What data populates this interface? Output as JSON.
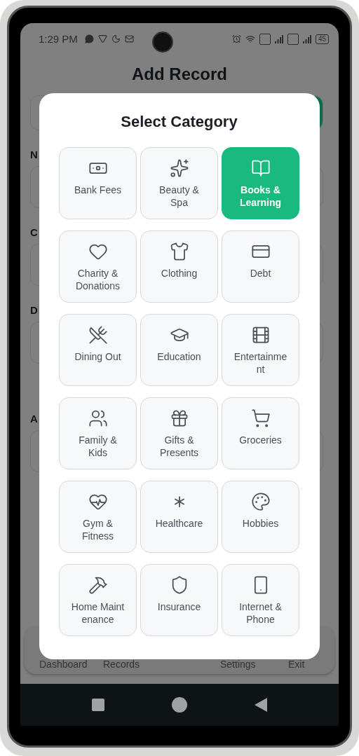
{
  "status_bar": {
    "time": "1:29 PM",
    "battery": "45"
  },
  "page": {
    "title": "Add Record",
    "fields": [
      {
        "label": "N"
      },
      {
        "label": "C"
      },
      {
        "label": "D"
      },
      {
        "label": "A"
      }
    ]
  },
  "dialog": {
    "title": "Select Category",
    "categories": [
      {
        "label": "Bank Fees",
        "selected": false
      },
      {
        "label": "Beauty & Spa",
        "selected": false
      },
      {
        "label": "Books & Learning",
        "selected": true
      },
      {
        "label": "Charity & Donations",
        "selected": false
      },
      {
        "label": "Clothing",
        "selected": false
      },
      {
        "label": "Debt",
        "selected": false
      },
      {
        "label": "Dining Out",
        "selected": false
      },
      {
        "label": "Education",
        "selected": false
      },
      {
        "label": "Entertainme nt",
        "selected": false
      },
      {
        "label": "Family & Kids",
        "selected": false
      },
      {
        "label": "Gifts & Presents",
        "selected": false
      },
      {
        "label": "Groceries",
        "selected": false
      },
      {
        "label": "Gym & Fitness",
        "selected": false
      },
      {
        "label": "Healthcare",
        "selected": false
      },
      {
        "label": "Hobbies",
        "selected": false
      },
      {
        "label": "Home Maint enance",
        "selected": false
      },
      {
        "label": "Insurance",
        "selected": false
      },
      {
        "label": "Internet & Phone",
        "selected": false
      }
    ]
  },
  "bottom_nav": {
    "items": [
      {
        "label": "Dashboard"
      },
      {
        "label": "Records"
      },
      {
        "label": "Settings"
      },
      {
        "label": "Exit"
      }
    ]
  }
}
